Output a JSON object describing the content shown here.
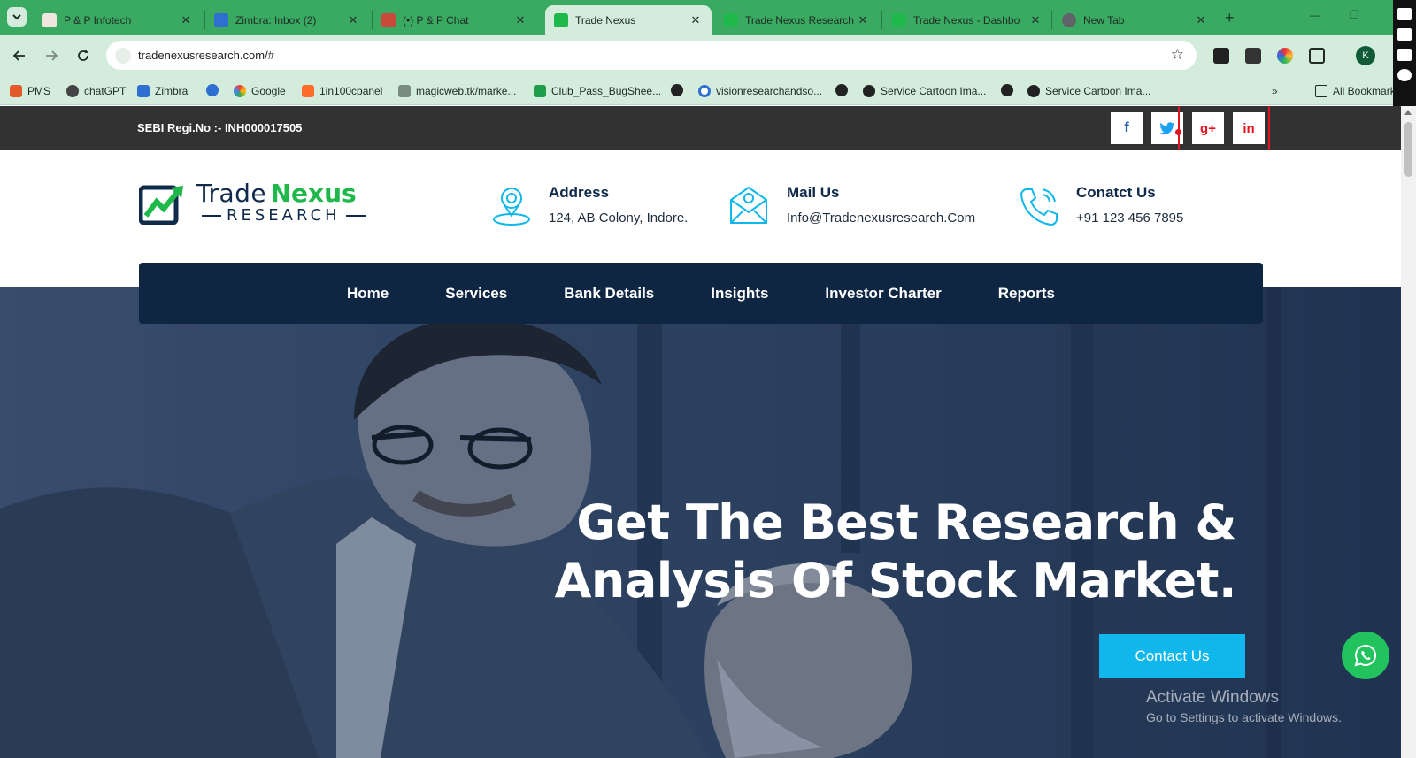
{
  "browser": {
    "tabs": [
      {
        "label": "P & P Infotech",
        "close": "✕"
      },
      {
        "label": "Zimbra: Inbox (2)",
        "close": "✕"
      },
      {
        "label": "(•) P & P Chat",
        "close": "✕"
      },
      {
        "label": "Trade Nexus",
        "close": "✕"
      },
      {
        "label": "Trade Nexus Research",
        "close": "✕"
      },
      {
        "label": "Trade Nexus - Dashbo",
        "close": "✕"
      },
      {
        "label": "New Tab",
        "close": "✕"
      }
    ],
    "active_tab_index": 3,
    "url": "tradenexusresearch.com/#",
    "avatar_initial": "K",
    "bookmarks": [
      {
        "label": "PMS"
      },
      {
        "label": "chatGPT"
      },
      {
        "label": "Zimbra"
      },
      {
        "label": "Google"
      },
      {
        "label": "1in100cpanel"
      },
      {
        "label": "magicweb.tk/marke..."
      },
      {
        "label": "Club_Pass_BugShee..."
      },
      {
        "label": "visionresearchandso..."
      },
      {
        "label": "Service Cartoon Ima..."
      },
      {
        "label": "Service Cartoon Ima..."
      },
      {
        "label": "All Bookmarks"
      }
    ],
    "overflow_label": "»"
  },
  "site": {
    "topbar": {
      "sebi": "SEBI Regi.No :- INH000017505",
      "social": [
        {
          "name": "facebook-icon",
          "glyph": "f",
          "color": "#1a5fa8"
        },
        {
          "name": "twitter-icon",
          "glyph": "🐦",
          "color": "#1da1f2"
        },
        {
          "name": "google-plus-icon",
          "glyph": "g+",
          "color": "#e0151f"
        },
        {
          "name": "linkedin-icon",
          "glyph": "in",
          "color": "#e0151f"
        }
      ]
    },
    "logo": {
      "word1": "Trade",
      "word2": "Nexus",
      "word3": "RESEARCH",
      "colors": {
        "navy": "#0f2a4a",
        "green": "#1fb84a"
      }
    },
    "contact_info": {
      "address": {
        "title": "Address",
        "value": "124, AB Colony, Indore."
      },
      "mail": {
        "title": "Mail Us",
        "value": "Info@Tradenexusresearch.Com"
      },
      "phone": {
        "title": "Conatct Us",
        "value": "+91 123 456 7895"
      }
    },
    "nav": [
      "Home",
      "Services",
      "Bank Details",
      "Insights",
      "Investor Charter",
      "Reports"
    ],
    "hero": {
      "headline_line1": "Get The Best Research &",
      "headline_line2": "Analysis Of Stock Market.",
      "cta": "Contact Us"
    },
    "windows_watermark": {
      "title": "Activate Windows",
      "subtitle": "Go to Settings to activate Windows."
    },
    "accent_colors": {
      "cta": "#0fb7ec",
      "whatsapp": "#22c35e",
      "navbar": "#0f2642",
      "topbar": "#323232",
      "highlight": "#e0151f"
    }
  }
}
